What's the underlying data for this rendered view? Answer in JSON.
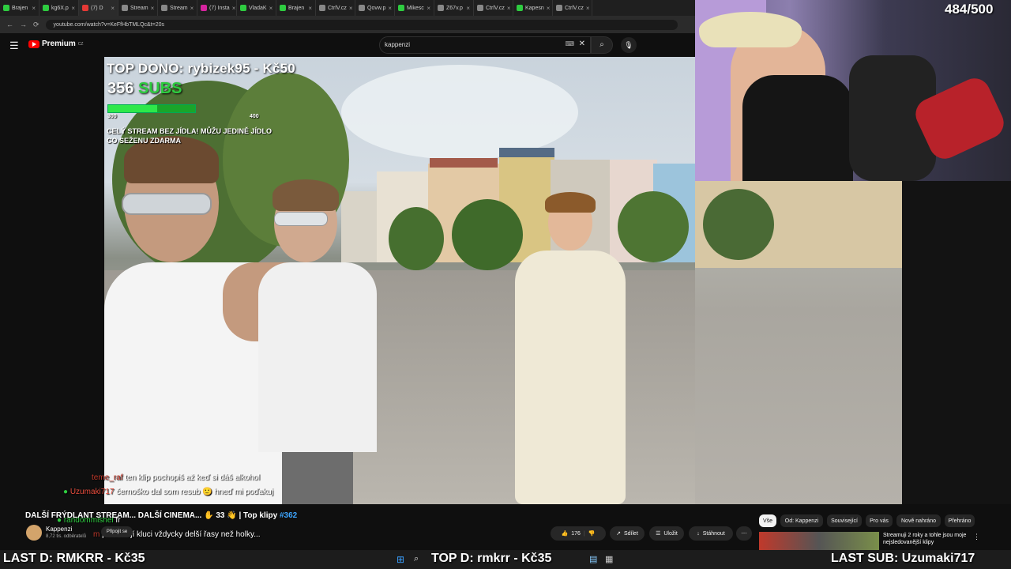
{
  "browser": {
    "tabs": [
      {
        "label": "Brajen",
        "color": "#2ecc40"
      },
      {
        "label": "kg6X.p",
        "color": "#2ecc40"
      },
      {
        "label": "(7) D",
        "color": "#e53935",
        "active": true
      },
      {
        "label": "Stream",
        "color": "#888888"
      },
      {
        "label": "Stream",
        "color": "#888888"
      },
      {
        "label": "(7) Insta",
        "color": "#d6249f"
      },
      {
        "label": "VladaK",
        "color": "#2ecc40"
      },
      {
        "label": "Brajen",
        "color": "#2ecc40"
      },
      {
        "label": "CtrlV.cz",
        "color": "#888888"
      },
      {
        "label": "Qovw.p",
        "color": "#888888"
      },
      {
        "label": "Mikesc",
        "color": "#2ecc40"
      },
      {
        "label": "Z67v.p",
        "color": "#888888"
      },
      {
        "label": "CtrlV.cz",
        "color": "#888888"
      },
      {
        "label": "Kapesn",
        "color": "#2ecc40"
      },
      {
        "label": "CtrlV.cz",
        "color": "#888888"
      }
    ],
    "url": "youtube.com/watch?v=KeFfHbTMLQc&t=20s"
  },
  "youtube": {
    "brand": "Premium",
    "region": "CZ",
    "search_value": "kappenzi"
  },
  "overlay": {
    "top_dono": "TOP DONO: rybizek95 - Kč50",
    "subs_count": "356",
    "subs_label": "SUBS",
    "progress_min": "300",
    "progress_max": "400",
    "progress_fraction": 0.56,
    "challenge": "CELÝ STREAM BEZ JÍDLA! MŮŽU JEDINĚ JÍDLO CO SEŽENU ZDARMA",
    "goal": "484/500"
  },
  "chat": [
    {
      "user": "teme_raf",
      "text": "ten klip pochopiš až keď si dáš alkohol"
    },
    {
      "user": "Uzumaki717",
      "text": "černoško dal som resub 🙂 hneď mi poďakuj"
    },
    {
      "user": "randommishel",
      "text": "fr"
    },
    {
      "user": "m",
      "text": "proč mají kluci vždycky delší řasy než holky..."
    }
  ],
  "video_info": {
    "title": "DALŠÍ FRÝDLANT STREAM... DALŠÍ CINEMA... ✋ 33 👋 | Top klipy",
    "hashtag": "#362",
    "channel": "Kappenzi",
    "subscribers": "8,72 tis. odběratelů",
    "join_label": "Připojit se",
    "likes": "176",
    "share": "Sdílet",
    "save": "Uložit",
    "download": "Stáhnout"
  },
  "filter_chips": [
    "Vše",
    "Od: Kappenzi",
    "Související",
    "Pro vás",
    "Nově nahráno",
    "Přehráno"
  ],
  "recommended": {
    "title": "Streamuji 2 roky a tohle jsou moje nejsledovanější klipy"
  },
  "bottom": {
    "last_donation": "LAST D: RMKRR - Kč35",
    "top_donation": "TOP D: rmkrr - Kč35",
    "last_sub": "LAST SUB: Uzumaki717"
  }
}
